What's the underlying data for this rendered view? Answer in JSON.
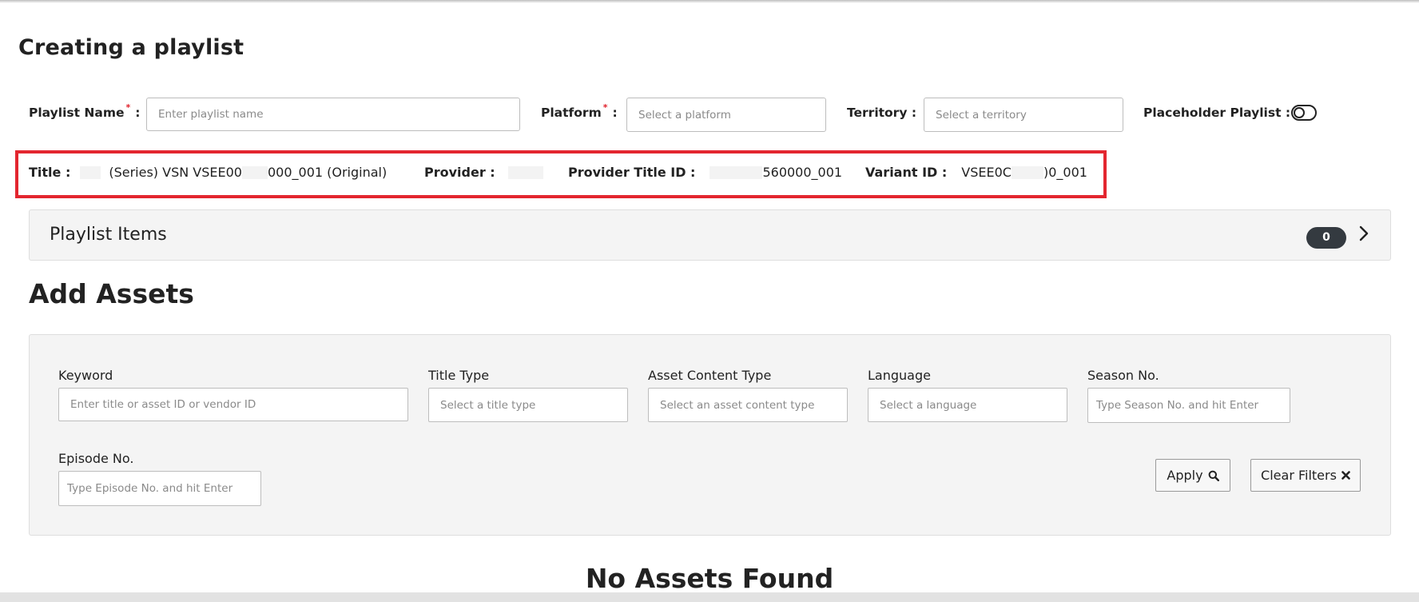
{
  "page": {
    "title": "Creating a playlist"
  },
  "form": {
    "playlist_name": {
      "label": "Playlist Name",
      "required": "*",
      "colon": ":",
      "placeholder": "Enter playlist name"
    },
    "platform": {
      "label": "Platform",
      "required": "*",
      "colon": ":",
      "placeholder": "Select a platform"
    },
    "territory": {
      "label": "Territory :",
      "placeholder": "Select a territory"
    },
    "placeholder_playlist": {
      "label": "Placeholder Playlist :",
      "enabled": false
    }
  },
  "info": {
    "title_label": "Title :",
    "title_value": "(Series) VSN VSEE00",
    "title_value_tail": "000_001 (Original)",
    "provider_label": "Provider :",
    "provider_title_id_label": "Provider Title ID :",
    "provider_title_id_value": "560000_001",
    "variant_id_label": "Variant ID :",
    "variant_id_value": "VSEE0C",
    "variant_id_tail": ")0_001"
  },
  "playlist_items": {
    "title": "Playlist Items",
    "count": "0"
  },
  "add_assets": {
    "title": "Add Assets",
    "filters": {
      "keyword": {
        "label": "Keyword",
        "placeholder": "Enter title or asset ID or vendor ID"
      },
      "title_type": {
        "label": "Title Type",
        "placeholder": "Select a title type"
      },
      "asset_content_type": {
        "label": "Asset Content Type",
        "placeholder": "Select an asset content type"
      },
      "language": {
        "label": "Language",
        "placeholder": "Select a language"
      },
      "season_no": {
        "label": "Season No.",
        "placeholder": "Type Season No. and hit Enter"
      },
      "episode_no": {
        "label": "Episode No.",
        "placeholder": "Type Episode No. and hit Enter"
      }
    },
    "apply_label": "Apply",
    "clear_label": "Clear Filters",
    "empty_message": "No Assets Found"
  },
  "icons": {
    "apply": "search-icon",
    "clear": "close-icon",
    "expand": "chevron-right-icon",
    "toggle": "toggle-switch-icon"
  },
  "colors": {
    "required": "#e0202b",
    "highlight_border": "#e3262f",
    "badge": "#343a40",
    "panel": "#f4f4f4"
  }
}
